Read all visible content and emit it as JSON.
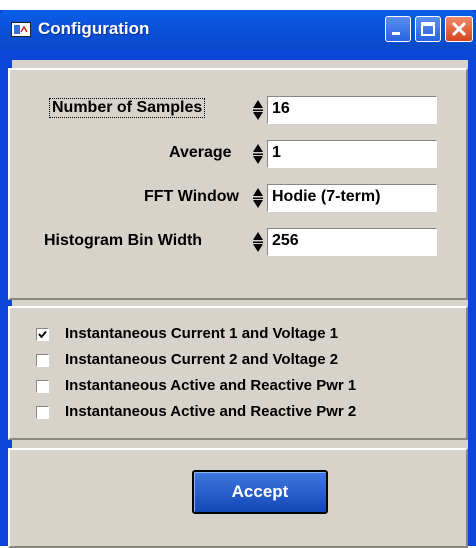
{
  "window": {
    "title": "Configuration"
  },
  "settings": {
    "fields": [
      {
        "label": "Number of Samples",
        "value": "16"
      },
      {
        "label": "Average",
        "value": "1"
      },
      {
        "label": "FFT Window",
        "value": "Hodie (7-term)"
      },
      {
        "label": "Histogram Bin Width",
        "value": "256"
      }
    ]
  },
  "checks": [
    {
      "label": "Instantaneous Current 1 and Voltage 1",
      "checked": true
    },
    {
      "label": "Instantaneous Current 2 and Voltage 2",
      "checked": false
    },
    {
      "label": "Instantaneous Active and Reactive Pwr 1",
      "checked": false
    },
    {
      "label": "Instantaneous Active and Reactive Pwr 2",
      "checked": false
    }
  ],
  "actions": {
    "accept_label": "Accept"
  },
  "colors": {
    "titlebar": "#0a52da",
    "client": "#d7d3cb",
    "accept_button": "#1f5ccf"
  }
}
